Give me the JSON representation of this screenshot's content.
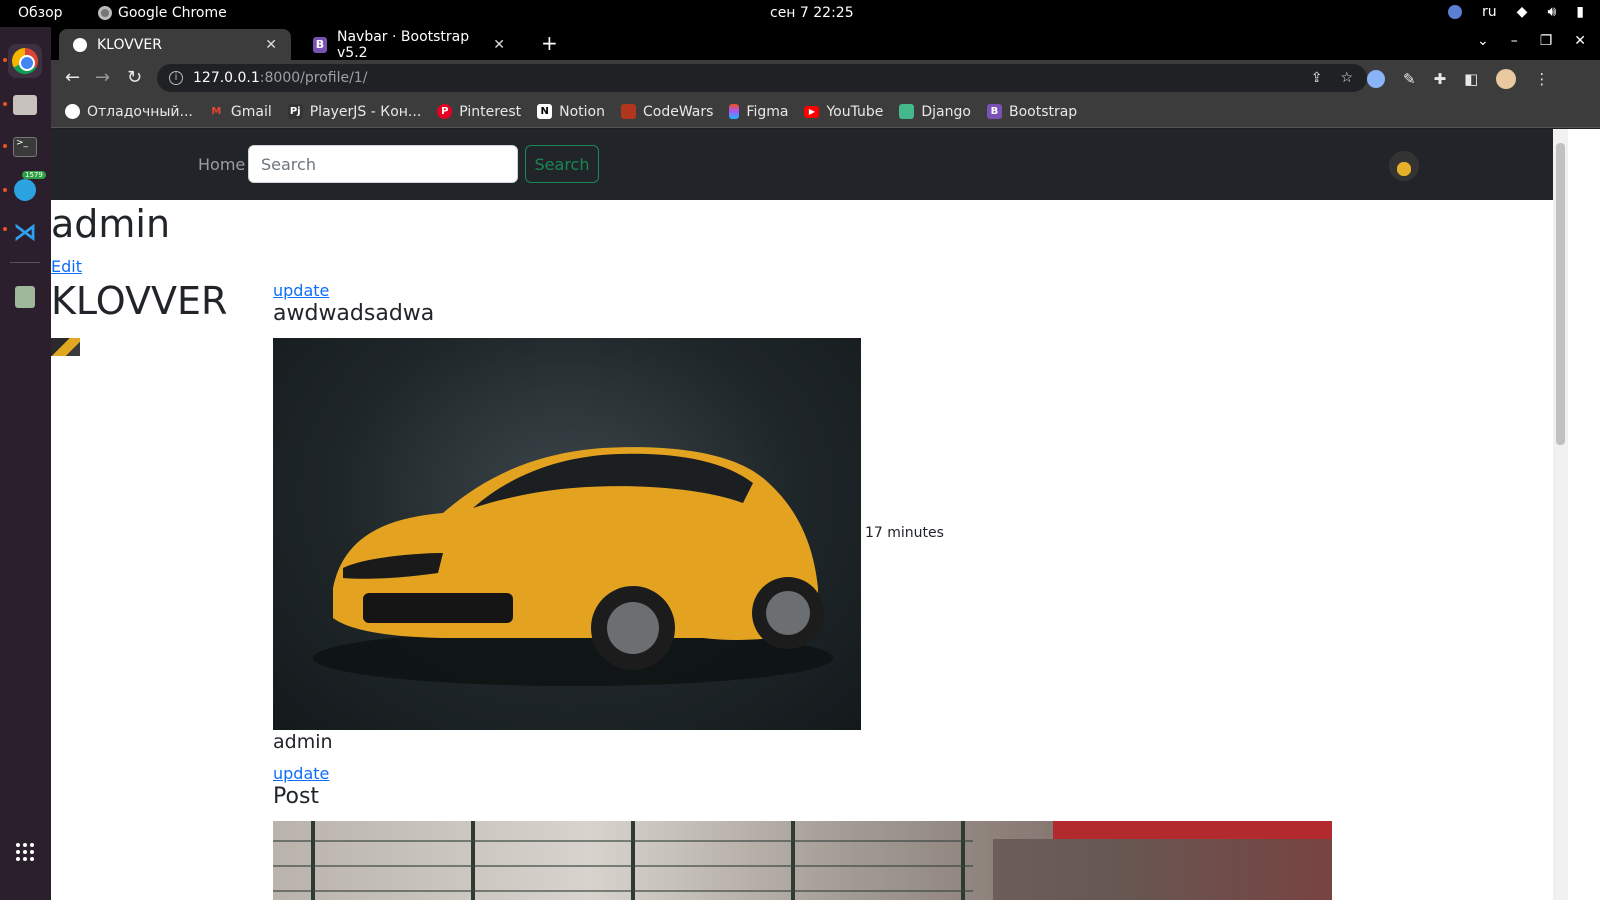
{
  "os": {
    "activities": "Обзор",
    "app_name": "Google Chrome",
    "clock": "сен 7  22:25",
    "lang": "ru",
    "telegram_badge": "1579"
  },
  "browser": {
    "tabs": [
      {
        "title": "KLOVVER",
        "favicon": "globe-icon",
        "active": true
      },
      {
        "title": "Navbar · Bootstrap v5.2",
        "favicon": "bootstrap-icon",
        "active": false
      }
    ],
    "url_host": "127.0.0.1",
    "url_rest": ":8000/profile/1/",
    "bookmarks": [
      {
        "label": "Отладочный...",
        "icon": "globe-icon",
        "color": "#ffffff"
      },
      {
        "label": "Gmail",
        "icon": "gmail-icon",
        "color": "#ea4335"
      },
      {
        "label": "PlayerJS - Кон...",
        "icon": "playerjs-icon",
        "color": "#333333"
      },
      {
        "label": "Pinterest",
        "icon": "pinterest-icon",
        "color": "#e60023"
      },
      {
        "label": "Notion",
        "icon": "notion-icon",
        "color": "#ffffff"
      },
      {
        "label": "CodeWars",
        "icon": "codewars-icon",
        "color": "#b1361e"
      },
      {
        "label": "Figma",
        "icon": "figma-icon",
        "color": "#f24e1e"
      },
      {
        "label": "YouTube",
        "icon": "youtube-icon",
        "color": "#ff0000"
      },
      {
        "label": "Django",
        "icon": "django-icon",
        "color": "#44b78b"
      },
      {
        "label": "Bootstrap",
        "icon": "bootstrap-icon",
        "color": "#7952b3"
      }
    ]
  },
  "site": {
    "nav": {
      "home": "Home",
      "search_placeholder": "Search",
      "search_button": "Search"
    },
    "profile": {
      "username": "admin",
      "edit_link": "Edit",
      "display_name": "KLOVVER"
    },
    "posts": [
      {
        "update_link": "update",
        "title": "awdwadsadwa",
        "time": "17 minutes",
        "author": "admin"
      },
      {
        "update_link": "update",
        "title": "Post"
      }
    ]
  }
}
